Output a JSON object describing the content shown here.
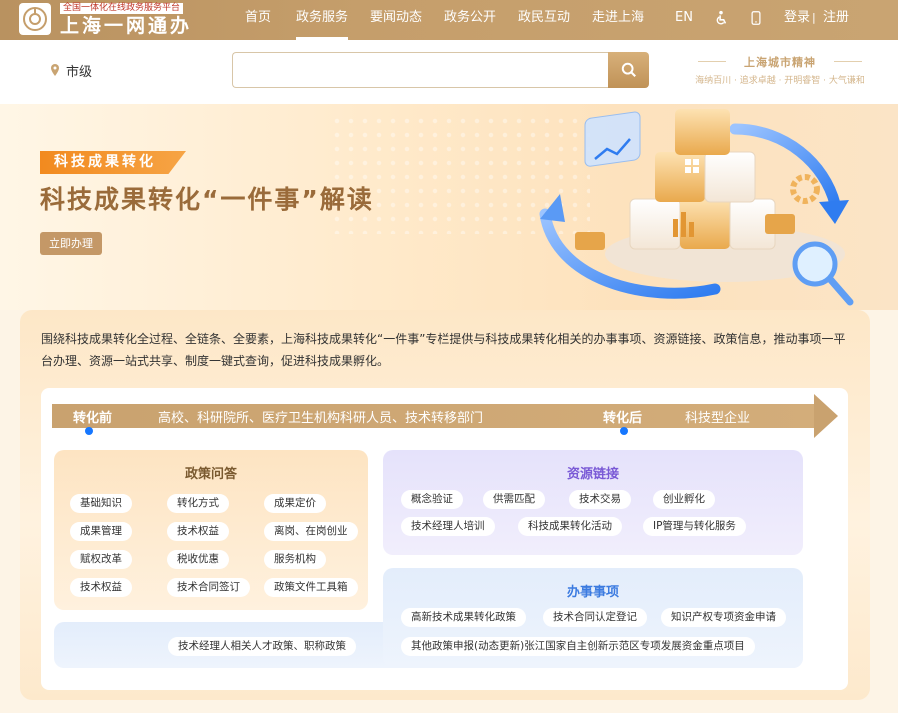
{
  "header": {
    "logo_sub": "全国一体化在线政务服务平台",
    "logo_main": "上海一网通办",
    "nav": [
      "首页",
      "政务服务",
      "要闻动态",
      "政务公开",
      "政民互动",
      "走进上海"
    ],
    "active_nav": "政务服务",
    "lang": "EN",
    "login": "登录",
    "sep": "|",
    "register": "注册",
    "accent_color": "#c59e6b"
  },
  "search": {
    "location": "市级",
    "placeholder": "",
    "slogan_title": "上海城市精神",
    "slogan_sub": "海纳百川 · 追求卓越 · 开明睿智 · 大气谦和"
  },
  "banner": {
    "tag": "科技成果转化",
    "title": "科技成果转化“一件事”解读",
    "button": "立即办理"
  },
  "main": {
    "intro": "围绕科技成果转化全过程、全链条、全要素，上海科技成果转化“一件事”专栏提供与科技成果转化相关的办事事项、资源链接、政策信息，推动事项一平台办理、资源一站式共享、制度一键式查询，促进科技成果孵化。",
    "flow": {
      "before_label": "转化前",
      "before_text": "高校、科研院所、医疗卫生机构科研人员、技术转移部门",
      "after_label": "转化后",
      "after_text": "科技型企业"
    },
    "policy": {
      "title": "政策问答",
      "items": [
        "基础知识",
        "转化方式",
        "成果定价",
        "成果管理",
        "技术权益",
        "离岗、在岗创业",
        "赋权改革",
        "税收优惠",
        "服务机构",
        "技术权益",
        "技术合同签订",
        "政策文件工具箱"
      ]
    },
    "resources": {
      "title": "资源链接",
      "items": [
        "概念验证",
        "供需匹配",
        "技术交易",
        "创业孵化",
        "技术经理人培训",
        "科技成果转化活动",
        "IP管理与转化服务"
      ]
    },
    "affairs": {
      "title": "办事事项",
      "items": [
        "高新技术成果转化政策",
        "技术合同认定登记",
        "知识产权专项资金申请",
        "技术经理人相关人才政策、职称政策",
        "其他政策申报(动态更新)张江国家自主创新示范区专项发展资金重点项目"
      ]
    }
  }
}
